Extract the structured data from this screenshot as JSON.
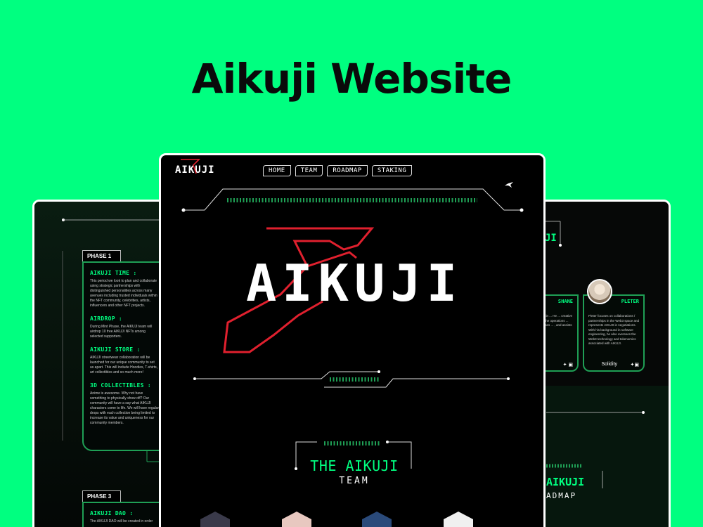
{
  "headline": "Aikuji Website",
  "left": {
    "phase1_label": "PHASE 1",
    "phase3_label": "PHASE 3",
    "sections": [
      {
        "title": "AIKUJI TIME :",
        "text": "This period we look to plan and collaborate using strategic partnerships with distinguished personalities across many avenues including trusted individuals within the NFT community, celebrities, artists, influencers and other NFT projects."
      },
      {
        "title": "AIRDROP :",
        "text": "During Mint Phase, the AIKUJI team will airdrop 10 free AIKUJI NFTs among selected supporters."
      },
      {
        "title": "AIKUJI STORE :",
        "text": "AIKUJI streetwear collaboration will be launched for our unique community to set us apart. This will include Hoodies, T-shirts, art collectibles and so much more!"
      },
      {
        "title": "3D COLLECTIBLES :",
        "text": "Anime is awesome. Why not have something to physically show off? Our community will have a say what AIKUJI characters come to life. We will have regular drops with each collection being limited to increase its value and uniqueness for our community members."
      }
    ],
    "phase3_title": "AIKUJI DAO :",
    "phase3_text": "The AIKUJI DAO will be created in order"
  },
  "center": {
    "logo_small": "AIKUJI",
    "nav": [
      "HOME",
      "TEAM",
      "ROADMAP",
      "STAKING"
    ],
    "hero_logo": "AIKUJI",
    "team_title": "THE AIKUJI",
    "team_sub": "TEAM"
  },
  "right": {
    "header_partial": "JI",
    "members": [
      {
        "name": "SHANE",
        "desc": "... a background in ... He ... creative team, makes ... the operations ... engineer, organises ... , and assists with ...",
        "role": ""
      },
      {
        "name": "PLETER",
        "desc": "Pieter focuses on collaborations / partnerships in the Web3 space and represents AIKUJI in negotiations. With his background in software engineering, he also oversees the Web3 technology and tokenomics associated with AIKUJI.",
        "role": "Solidity"
      }
    ],
    "roadmap_title": "AIKUJI",
    "roadmap_sub": "ADMAP"
  },
  "colors": {
    "bg": "#00ff80",
    "accent": "#00ff80",
    "red": "#e0202e",
    "panel": "#000000"
  }
}
